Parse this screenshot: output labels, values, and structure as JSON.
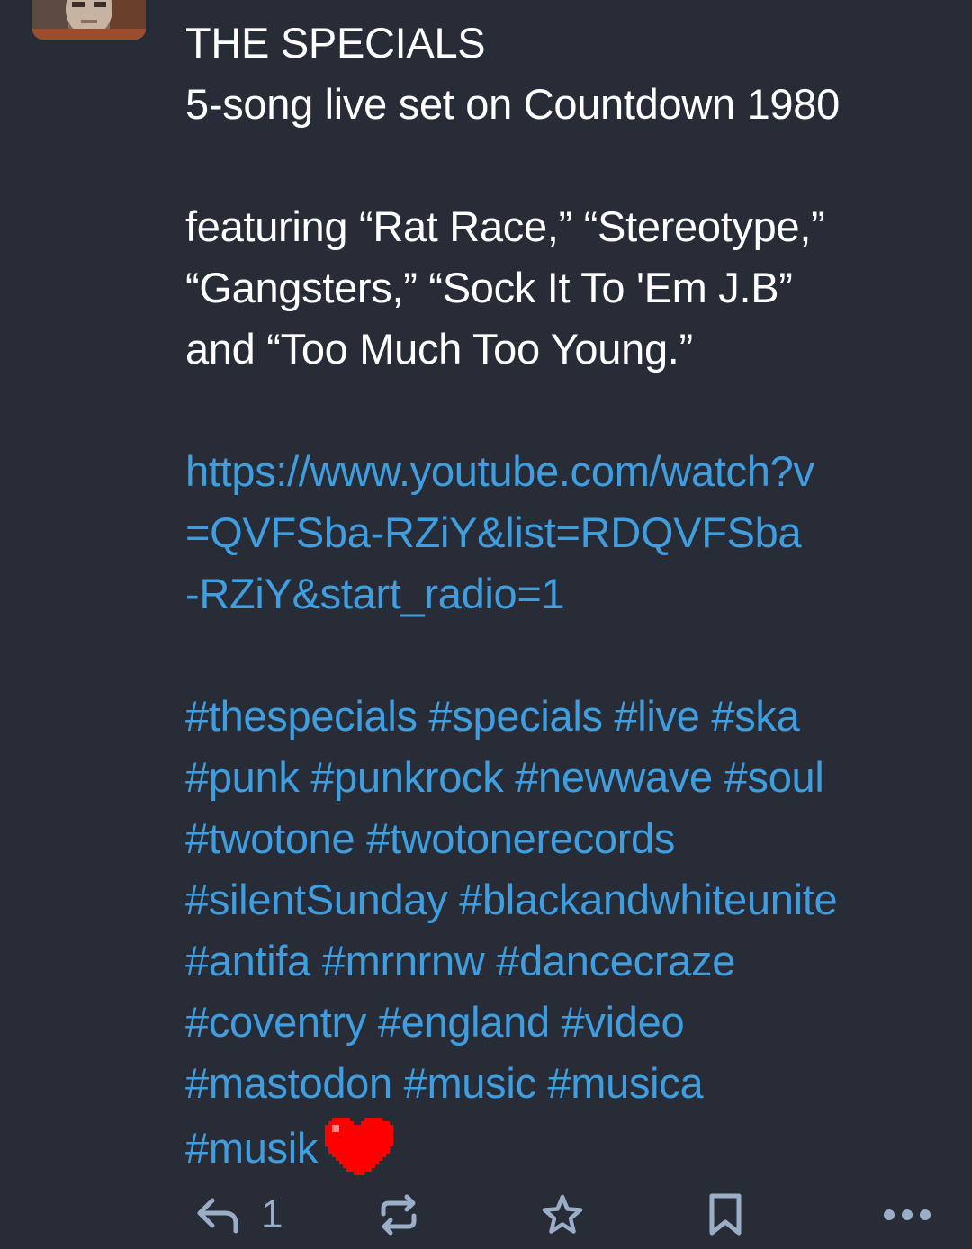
{
  "post": {
    "title": "THE SPECIALS",
    "subtitle": "5-song live set on Countdown 1980",
    "featuring_lines": [
      "featuring “Rat Race,” “Stereotype,”",
      "“Gangsters,” “Sock It To 'Em J.B”",
      "and “Too Much Too Young.”"
    ],
    "link_lines": [
      "https://www.youtube.com/watch?v",
      "=QVFSba-RZiY&list=RDQVFSba",
      "-RZiY&start_radio=1"
    ],
    "hashtag_lines": [
      "#thespecials #specials #live #ska",
      "#punk #punkrock #newwave #soul",
      "#twotone #twotonerecords",
      "#silentSunday #blackandwhiteunite",
      "#antifa #mrnrnw #dancecraze",
      "#coventry #england #video",
      "#mastodon #music #musica",
      "#musik"
    ],
    "emoji": "heart-emoji"
  },
  "actions": {
    "reply_icon": "reply-icon",
    "reply_count": "1",
    "boost_icon": "boost-icon",
    "favourite_icon": "star-icon",
    "bookmark_icon": "bookmark-icon",
    "more_icon": "more-icon"
  },
  "colors": {
    "background": "#282c37",
    "text": "#ffffff",
    "link": "#3e9ee0",
    "action_icons": "#9baec8",
    "heart": "#ff0000"
  }
}
